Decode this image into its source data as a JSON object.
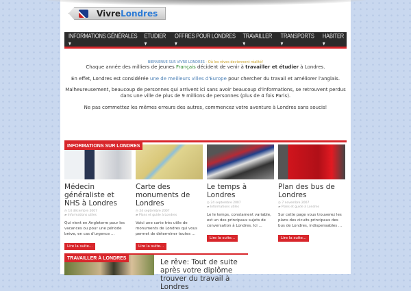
{
  "logo": {
    "text_a": "Vivre",
    "text_b": "Londres"
  },
  "nav": [
    "INFORMATIONS GÉNÉRALES ▾",
    "ETUDIER ▾",
    "OFFRES POUR LONDRES ▾",
    "TRAVAILLER ▾",
    "TRANSPORTS ▾",
    "HABITER ▾"
  ],
  "intro": {
    "welcome": "BIENVENUE SUR VIVRE LONDRES",
    "welcome_sep": " - ",
    "tagline": "Où les rêves deviennent réalité!",
    "p1a": "Chaque année des milliers de jeunes ",
    "p1b": "Français",
    "p1c": " décident de venir à ",
    "p1d": "travailler et étudier",
    "p1e": " à Londres.",
    "p2a": "En effet, Londres est considérée ",
    "p2b": "une de meilleurs villes d'Europe",
    "p2c": " pour chercher du travail et améliorer l'anglais.",
    "p3": "Malheureusement, beaucoup de personnes qui arrivent ici sans avoir beaucoup d'informations, se retrouvent perdus dans une ville de plus de 9 millions de personnes (plus de 4 fois Paris).",
    "p4": "Ne pas commettez les mêmes erreurs des autres, commencez votre aventure à Londres sans soucis!"
  },
  "section1": {
    "label": "INFORMATIONS SUR LONDRES",
    "cards": [
      {
        "title": "Médecin généraliste et NHS à Londres",
        "date": "◷ 14 décembre 2007",
        "category": "▰ Informations utiles",
        "excerpt": "Qui vient en Angleterre pour les vacances ou pour une période brève, en cas d'urgence ...",
        "button": "Lire la suite..."
      },
      {
        "title": "Carte des monuments de Londres",
        "date": "◷ 24 septembre 2007",
        "category": "▰ Plans et guide à Londres",
        "excerpt": "Voici une carte très utile de monuments de Londres qui vous permet de déterminer toutes ...",
        "button": "Lire la suite..."
      },
      {
        "title": "Le temps à Londres",
        "date": "◷ 24 septembre 2007",
        "category": "▰ Informations utiles",
        "excerpt": "Le le temps, constament variable, est un des principaux sujets de conversation à Londres. Ici ...",
        "button": "Lire la suite..."
      },
      {
        "title": "Plan des bus de Londres",
        "date": "◷ 7 novembre 2007",
        "category": "▰ Plans et guide à Londres",
        "excerpt": "Sur cette page vous trouverez les plans des cicuits principaux des bus de Londres, indispensables ...",
        "button": "Lire la suite..."
      }
    ]
  },
  "section2": {
    "label": "TRAVAILLER À LONDRES",
    "title": "Le rêve: Tout de suite après votre diplôme trouver du travail à Londres"
  }
}
